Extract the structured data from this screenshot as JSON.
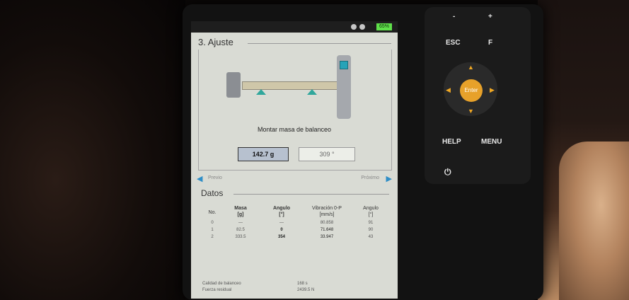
{
  "screen": {
    "battery": "65%",
    "title": "3. Ajuste",
    "caption": "Montar masa de balanceo",
    "mass_value": "142.7 g",
    "angle_value": "309 °",
    "nav": {
      "prev": "Previo",
      "next": "Próximo"
    },
    "datos": {
      "title": "Datos",
      "headers": [
        {
          "line1": "No.",
          "line2": ""
        },
        {
          "line1": "Masa",
          "line2": "[g]"
        },
        {
          "line1": "Angulo",
          "line2": "[°]"
        },
        {
          "line1": "Vibración 0-P",
          "line2": "[mm/s]"
        },
        {
          "line1": "Angulo",
          "line2": "[°]"
        }
      ],
      "rows": [
        [
          "0",
          "—",
          "—",
          "80.858",
          "91"
        ],
        [
          "1",
          "82.5",
          "0",
          "71.648",
          "90"
        ],
        [
          "2",
          "333.5",
          "354",
          "33.947",
          "43"
        ]
      ]
    },
    "footer": {
      "label1": "Calidad de balanceo",
      "value1": "168 s",
      "label2": "Fuerza residual",
      "value2": "2439.5 N"
    }
  },
  "keypad": {
    "minus": "-",
    "plus": "+",
    "esc": "ESC",
    "f": "F",
    "enter": "Enter",
    "help": "HELP",
    "menu": "MENU",
    "power": "⏻"
  },
  "colors": {
    "accent": "#2f8ec7",
    "battery": "#5fe04a",
    "enter": "#e7a12a",
    "support": "#30a79c"
  }
}
